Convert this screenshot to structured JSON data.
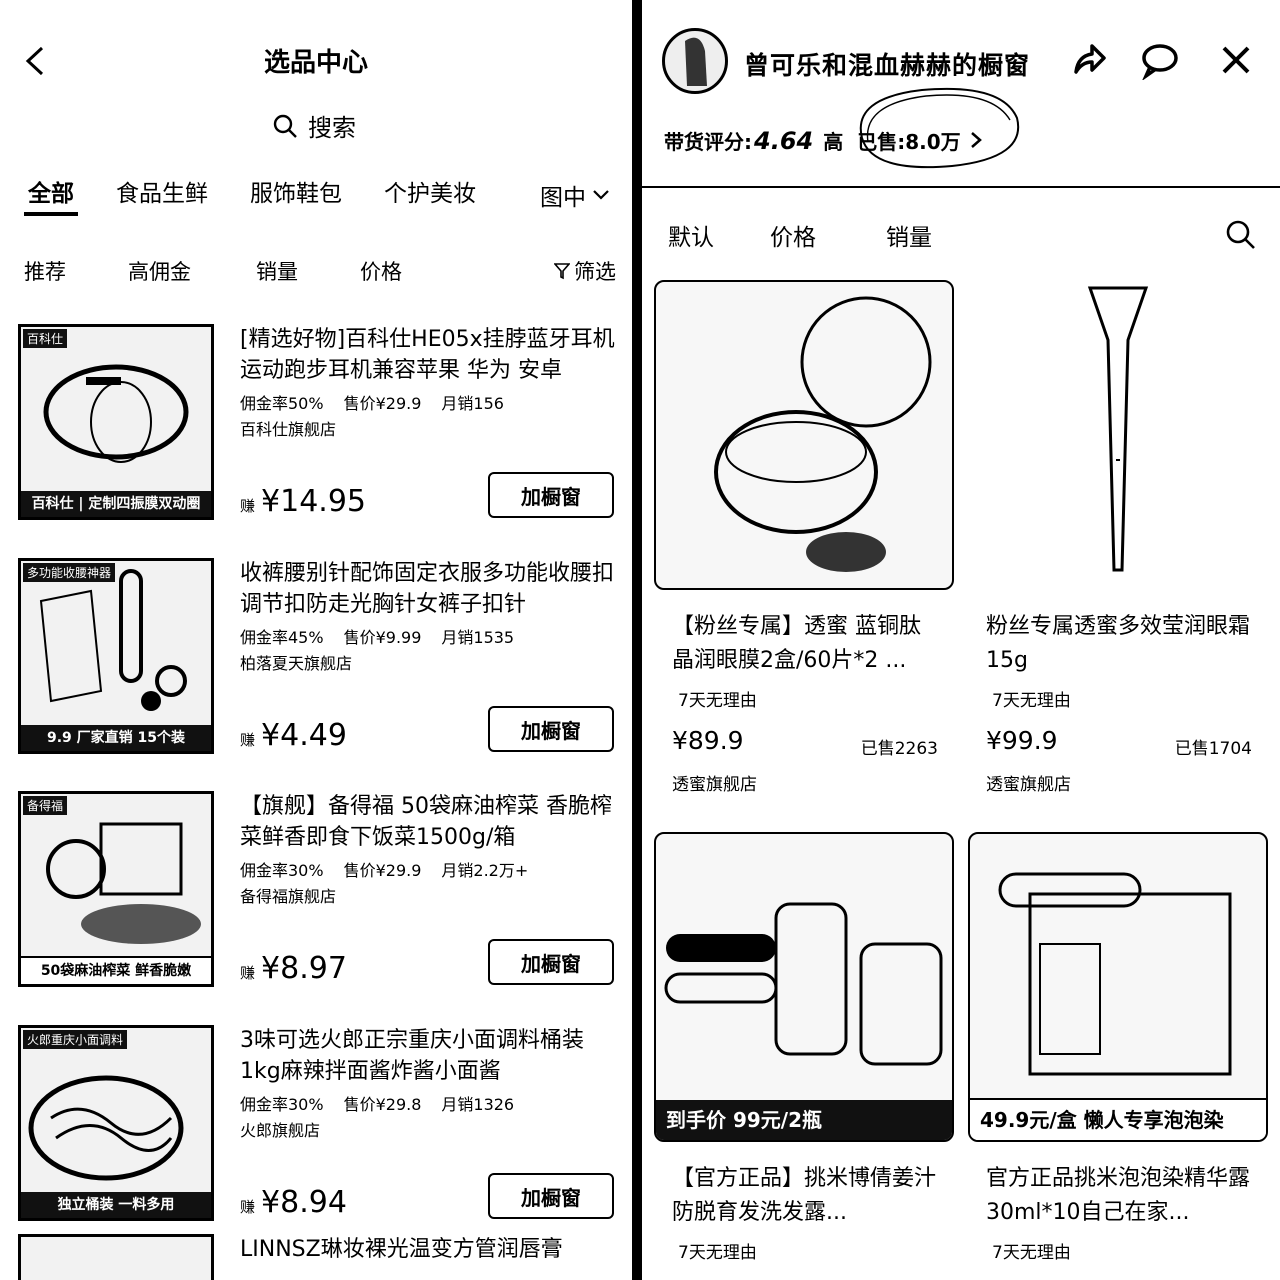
{
  "left": {
    "title": "选品中心",
    "search_label": "搜索",
    "categories": [
      "全部",
      "食品生鲜",
      "服饰鞋包",
      "个护美妆"
    ],
    "category_more": "图中",
    "sorts": [
      "推荐",
      "高佣金",
      "销量",
      "价格"
    ],
    "filter_label": "筛选",
    "earn_label": "赚",
    "add_label": "加橱窗",
    "products": [
      {
        "title": "[精选好物]百科仕HE05x挂脖蓝牙耳机运动跑步耳机兼容苹果 华为 安卓",
        "rate": "佣金率50%",
        "price": "售价¥29.9",
        "sales": "月销156",
        "store": "百科仕旗舰店",
        "earn": "¥14.95",
        "tag": "百科仕",
        "caption": "百科仕 | 定制四振膜双动圈"
      },
      {
        "title": "收裤腰别针配饰固定衣服多功能收腰扣调节扣防走光胸针女裤子扣针",
        "rate": "佣金率45%",
        "price": "售价¥9.99",
        "sales": "月销1535",
        "store": "柏落夏天旗舰店",
        "earn": "¥4.49",
        "tag": "多功能收腰神器",
        "caption": "9.9 厂家直销 15个装"
      },
      {
        "title": "【旗舰】备得福 50袋麻油榨菜 香脆榨菜鲜香即食下饭菜1500g/箱",
        "rate": "佣金率30%",
        "price": "售价¥29.9",
        "sales": "月销2.2万+",
        "store": "备得福旗舰店",
        "earn": "¥8.97",
        "tag": "备得福",
        "caption": "50袋麻油榨菜 鲜香脆嫩"
      },
      {
        "title": "3味可选火郎正宗重庆小面调料桶装1kg麻辣拌面酱炸酱小面酱",
        "rate": "佣金率30%",
        "price": "售价¥29.8",
        "sales": "月销1326",
        "store": "火郎旗舰店",
        "earn": "¥8.94",
        "tag": "火郎重庆小面调料",
        "caption": "独立桶装 一料多用"
      }
    ],
    "peek_title": "LINNSZ琳妆裸光温变方管润唇膏"
  },
  "right": {
    "shop_name": "曾可乐和混血赫赫的橱窗",
    "score_label": "带货评分:",
    "score_value": "4.64",
    "score_level": "高",
    "sold_label": "已售:8.0万",
    "tabs": [
      "默认",
      "价格",
      "销量"
    ],
    "cards": [
      {
        "title": "【粉丝专属】透蜜 蓝铜肽晶润眼膜2盒/60片*2 ...",
        "reason": "7天无理由",
        "price": "¥89.9",
        "sold": "已售2263",
        "store": "透蜜旗舰店",
        "banner": ""
      },
      {
        "title": "粉丝专属透蜜多效莹润眼霜15g",
        "reason": "7天无理由",
        "price": "¥99.9",
        "sold": "已售1704",
        "store": "透蜜旗舰店",
        "banner": ""
      },
      {
        "title": "【官方正品】挑米博倩姜汁防脱育发洗发露...",
        "reason": "7天无理由",
        "price": "",
        "sold": "",
        "store": "",
        "banner": "到手价 99元/2瓶"
      },
      {
        "title": "官方正品挑米泡泡染精华露30ml*10自己在家...",
        "reason": "7天无理由",
        "price": "",
        "sold": "",
        "store": "",
        "banner": "49.9元/盒 懒人专享泡泡染"
      }
    ]
  }
}
